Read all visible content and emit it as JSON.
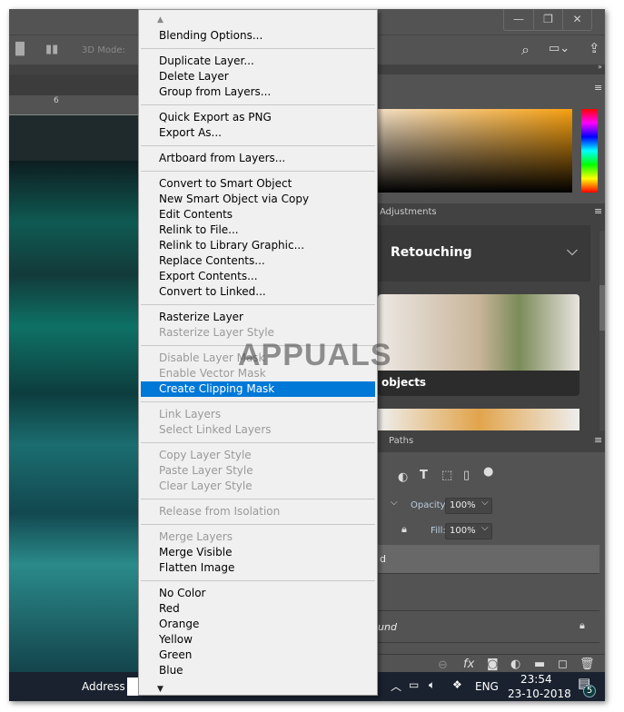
{
  "window": {
    "controls": [
      "—",
      "❐",
      "✕"
    ]
  },
  "options_bar": {
    "mode_label": "3D Mode:"
  },
  "ruler": {
    "tick": "6"
  },
  "panels": {
    "adjustments_tab": "Adjustments",
    "learn_title": "Retouching",
    "card_label": "objects",
    "paths_tab": "Paths",
    "opacity_label": "Opacity:",
    "opacity_value": "100%",
    "fill_label": "Fill:",
    "fill_value": "100%",
    "layer1": "d",
    "layer3": "und"
  },
  "menu": {
    "items": [
      {
        "label": "Blending Options..."
      },
      {
        "sep": true
      },
      {
        "label": "Duplicate Layer..."
      },
      {
        "label": "Delete Layer"
      },
      {
        "label": "Group from Layers..."
      },
      {
        "sep": true
      },
      {
        "label": "Quick Export as PNG"
      },
      {
        "label": "Export As..."
      },
      {
        "sep": true
      },
      {
        "label": "Artboard from Layers..."
      },
      {
        "sep": true
      },
      {
        "label": "Convert to Smart Object"
      },
      {
        "label": "New Smart Object via Copy"
      },
      {
        "label": "Edit Contents"
      },
      {
        "label": "Relink to File..."
      },
      {
        "label": "Relink to Library Graphic..."
      },
      {
        "label": "Replace Contents..."
      },
      {
        "label": "Export Contents..."
      },
      {
        "label": "Convert to Linked..."
      },
      {
        "sep": true
      },
      {
        "label": "Rasterize Layer"
      },
      {
        "label": "Rasterize Layer Style",
        "disabled": true
      },
      {
        "sep": true
      },
      {
        "label": "Disable Layer Mask",
        "disabled": true
      },
      {
        "label": "Enable Vector Mask",
        "disabled": true
      },
      {
        "label": "Create Clipping Mask",
        "selected": true
      },
      {
        "sep": true
      },
      {
        "label": "Link Layers",
        "disabled": true
      },
      {
        "label": "Select Linked Layers",
        "disabled": true
      },
      {
        "sep": true
      },
      {
        "label": "Copy Layer Style",
        "disabled": true
      },
      {
        "label": "Paste Layer Style",
        "disabled": true
      },
      {
        "label": "Clear Layer Style",
        "disabled": true
      },
      {
        "sep": true
      },
      {
        "label": "Release from Isolation",
        "disabled": true
      },
      {
        "sep": true
      },
      {
        "label": "Merge Layers",
        "disabled": true
      },
      {
        "label": "Merge Visible"
      },
      {
        "label": "Flatten Image"
      },
      {
        "sep": true
      },
      {
        "label": "No Color"
      },
      {
        "label": "Red"
      },
      {
        "label": "Orange"
      },
      {
        "label": "Yellow"
      },
      {
        "label": "Green"
      },
      {
        "label": "Blue"
      }
    ]
  },
  "taskbar": {
    "address_label": "Address",
    "language": "ENG",
    "time": "23:54",
    "date": "23-10-2018",
    "notifications": "5"
  },
  "watermark": "APPUALS",
  "colors": {
    "accent": "#0078d7",
    "taskbar": "#1a2230"
  }
}
